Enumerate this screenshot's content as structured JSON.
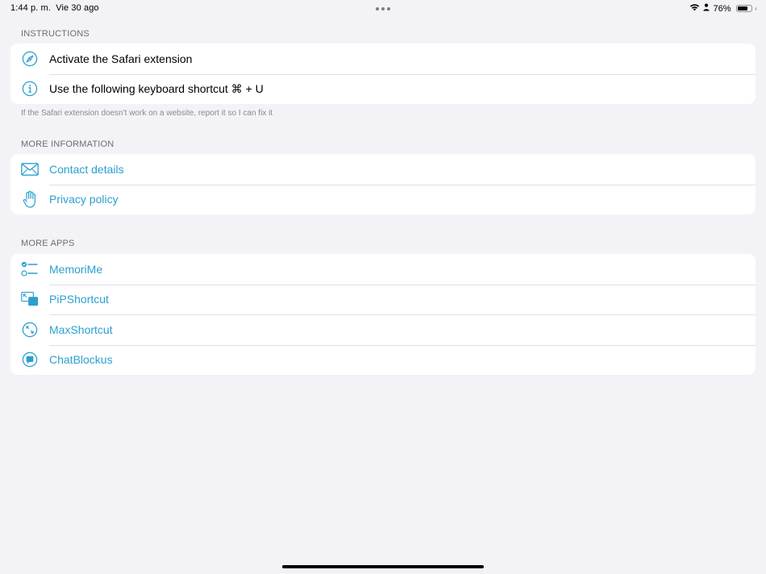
{
  "status_bar": {
    "time": "1:44 p. m.",
    "date": "Vie 30 ago",
    "battery_percent": "76%",
    "battery_level": 0.76,
    "wifi_icon": "wifi-icon",
    "person_icon": "person-icon"
  },
  "colors": {
    "background": "#f2f2f7",
    "accent": "#2aa0cf",
    "header_text": "#6d6d72"
  },
  "instructions": {
    "header": "INSTRUCTIONS",
    "items": [
      {
        "icon": "compass-icon",
        "label": "Activate the Safari extension"
      },
      {
        "icon": "info-icon",
        "label": "Use the following keyboard shortcut ⌘ + U"
      }
    ],
    "footer": "If the Safari extension doesn't work on a website, report it so I can fix it"
  },
  "more_information": {
    "header": "MORE INFORMATION",
    "items": [
      {
        "icon": "envelope-icon",
        "label": "Contact details"
      },
      {
        "icon": "hand-icon",
        "label": "Privacy policy"
      }
    ]
  },
  "more_apps": {
    "header": "MORE APPS",
    "items": [
      {
        "icon": "checklist-icon",
        "label": "MemoriMe"
      },
      {
        "icon": "pip-icon",
        "label": "PiPShortcut"
      },
      {
        "icon": "expand-icon",
        "label": "MaxShortcut"
      },
      {
        "icon": "chat-bubble-icon",
        "label": "ChatBlockus"
      }
    ]
  }
}
